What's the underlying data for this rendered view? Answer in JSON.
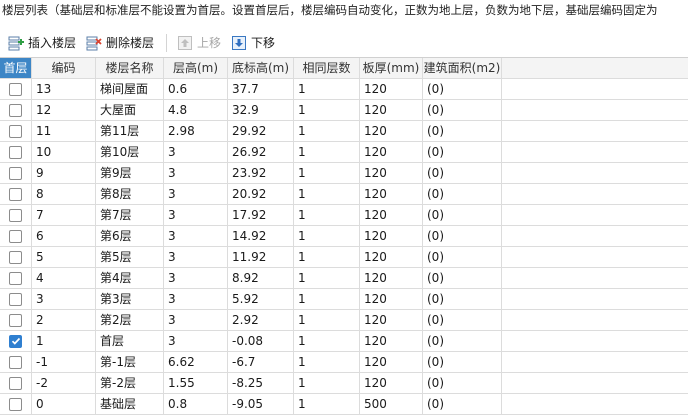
{
  "info_text": "楼层列表（基础层和标准层不能设置为首层。设置首层后，楼层编码自动变化，正数为地上层，负数为地下层，基础层编码固定为",
  "toolbar": {
    "insert_label": "插入楼层",
    "delete_label": "删除楼层",
    "move_up_label": "上移",
    "move_down_label": "下移"
  },
  "table": {
    "headers": [
      "首层",
      "编码",
      "楼层名称",
      "层高(m)",
      "底标高(m)",
      "相同层数",
      "板厚(mm)",
      "建筑面积(m2)"
    ],
    "rows": [
      {
        "checked": false,
        "code": "13",
        "name": "梯间屋面",
        "height": "0.6",
        "base_elev": "37.7",
        "same_count": "1",
        "slab": "120",
        "area": "(0)"
      },
      {
        "checked": false,
        "code": "12",
        "name": "大屋面",
        "height": "4.8",
        "base_elev": "32.9",
        "same_count": "1",
        "slab": "120",
        "area": "(0)"
      },
      {
        "checked": false,
        "code": "11",
        "name": "第11层",
        "height": "2.98",
        "base_elev": "29.92",
        "same_count": "1",
        "slab": "120",
        "area": "(0)"
      },
      {
        "checked": false,
        "code": "10",
        "name": "第10层",
        "height": "3",
        "base_elev": "26.92",
        "same_count": "1",
        "slab": "120",
        "area": "(0)"
      },
      {
        "checked": false,
        "code": "9",
        "name": "第9层",
        "height": "3",
        "base_elev": "23.92",
        "same_count": "1",
        "slab": "120",
        "area": "(0)"
      },
      {
        "checked": false,
        "code": "8",
        "name": "第8层",
        "height": "3",
        "base_elev": "20.92",
        "same_count": "1",
        "slab": "120",
        "area": "(0)"
      },
      {
        "checked": false,
        "code": "7",
        "name": "第7层",
        "height": "3",
        "base_elev": "17.92",
        "same_count": "1",
        "slab": "120",
        "area": "(0)"
      },
      {
        "checked": false,
        "code": "6",
        "name": "第6层",
        "height": "3",
        "base_elev": "14.92",
        "same_count": "1",
        "slab": "120",
        "area": "(0)"
      },
      {
        "checked": false,
        "code": "5",
        "name": "第5层",
        "height": "3",
        "base_elev": "11.92",
        "same_count": "1",
        "slab": "120",
        "area": "(0)"
      },
      {
        "checked": false,
        "code": "4",
        "name": "第4层",
        "height": "3",
        "base_elev": "8.92",
        "same_count": "1",
        "slab": "120",
        "area": "(0)"
      },
      {
        "checked": false,
        "code": "3",
        "name": "第3层",
        "height": "3",
        "base_elev": "5.92",
        "same_count": "1",
        "slab": "120",
        "area": "(0)"
      },
      {
        "checked": false,
        "code": "2",
        "name": "第2层",
        "height": "3",
        "base_elev": "2.92",
        "same_count": "1",
        "slab": "120",
        "area": "(0)"
      },
      {
        "checked": true,
        "code": "1",
        "name": "首层",
        "height": "3",
        "base_elev": "-0.08",
        "same_count": "1",
        "slab": "120",
        "area": "(0)"
      },
      {
        "checked": false,
        "code": "-1",
        "name": "第-1层",
        "height": "6.62",
        "base_elev": "-6.7",
        "same_count": "1",
        "slab": "120",
        "area": "(0)"
      },
      {
        "checked": false,
        "code": "-2",
        "name": "第-2层",
        "height": "1.55",
        "base_elev": "-8.25",
        "same_count": "1",
        "slab": "120",
        "area": "(0)"
      },
      {
        "checked": false,
        "code": "0",
        "name": "基础层",
        "height": "0.8",
        "base_elev": "-9.05",
        "same_count": "1",
        "slab": "500",
        "area": "(0)"
      }
    ]
  },
  "colors": {
    "header_accent": "#3d86c6",
    "checkbox_checked": "#2f7fd0"
  }
}
